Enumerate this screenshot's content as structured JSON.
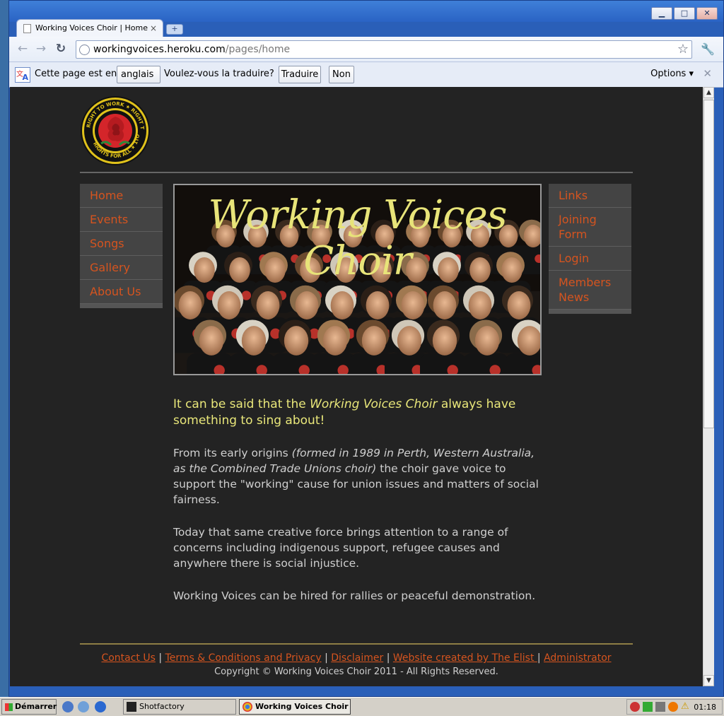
{
  "browser": {
    "tab_title": "Working Voices Choir | Home",
    "tab_close": "×",
    "new_tab": "+",
    "url_host": "workingvoices.heroku.com",
    "url_path": "/pages/home",
    "window_buttons": [
      "▁",
      "□",
      "✕"
    ]
  },
  "translate_bar": {
    "prefix": "Cette page est en",
    "language": "anglais ▾",
    "question": "Voulez-vous la traduire?",
    "translate_button": "Traduire",
    "no_button": "Non",
    "options": "Options ▾",
    "close": "✕"
  },
  "site": {
    "hero_title": "Working Voices Choir",
    "left_nav": [
      "Home",
      "Events",
      "Songs",
      "Gallery",
      "About Us"
    ],
    "right_nav": [
      "Links",
      "Joining Form",
      "Login",
      "Members News"
    ],
    "lead_part1": "It can be said that the ",
    "lead_italic": "Working Voices Choir",
    "lead_part2": " always have something to sing about!",
    "p1_part1": "From its early origins ",
    "p1_italic": "(formed in 1989 in Perth, Western Australia, as the Combined Trade Unions choir)",
    "p1_part2": " the choir gave voice to support the \"working\" cause for union issues and matters of social fairness.",
    "p2": "Today that same creative force brings attention to a range of concerns including indigenous support, refugee causes and anywhere there is social injustice.",
    "p3": "Working Voices can be hired for rallies or peaceful demonstration.",
    "footer_links": [
      "Contact Us",
      "Terms & Conditions and Privacy",
      "Disclaimer",
      "Website created by The Elist ",
      "Administrator"
    ],
    "copyright": "Copyright © Working Voices Choir 2011 - All Rights Reserved.",
    "logo_text_top": "RIGHT TO WORK • RIGHT TO REST",
    "logo_text_bottom": "RIGHTS FOR ALL • 1TO1 •"
  },
  "taskbar": {
    "start": "Démarrer",
    "tasks": [
      "Shotfactory",
      "Working Voices Choir ..."
    ],
    "clock": "01:18"
  },
  "colors": {
    "link_orange": "#d5541f",
    "lead_yellow": "#e9e77a",
    "page_bg": "#232323"
  }
}
